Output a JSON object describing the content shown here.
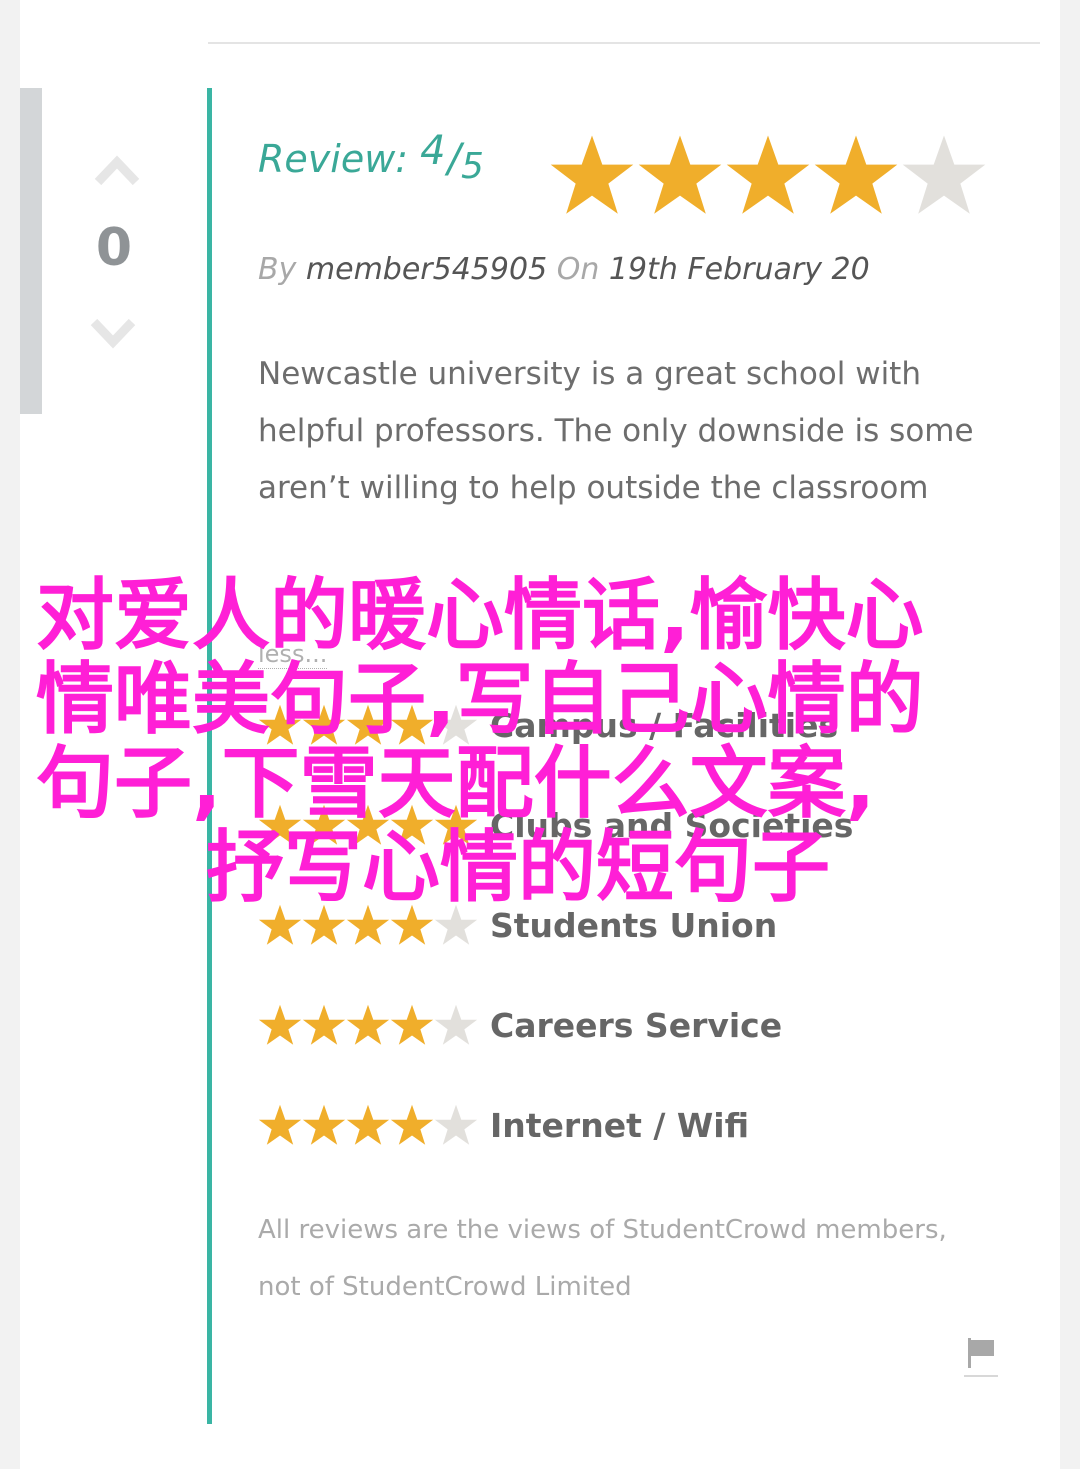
{
  "vote": {
    "count": "0",
    "up_icon": "chevron-up-icon",
    "down_icon": "chevron-down-icon"
  },
  "review": {
    "label": "Review:",
    "score": "4",
    "separator": "/",
    "max": "5",
    "stars_filled": 4,
    "stars_total": 5,
    "by_label": "By",
    "author": "member545905",
    "on_label": "On",
    "date": "19th February 20",
    "body": "Newcastle university is a great school with helpful professors. The only downside is some aren’t willing to help outside the classroom",
    "less_link": "less..."
  },
  "ratings": [
    {
      "label": "Campus / Facilities",
      "stars": 4
    },
    {
      "label": "Clubs and Societies",
      "stars": 5
    },
    {
      "label": "Students Union",
      "stars": 4
    },
    {
      "label": "Careers Service",
      "stars": 4
    },
    {
      "label": "Internet / Wifi",
      "stars": 4
    }
  ],
  "disclaimer": {
    "line1": "All reviews are the views of StudentCrowd members,",
    "line2": "not of StudentCrowd Limited"
  },
  "flag_icon": "flag-icon",
  "overlay": {
    "line1": "对爱人的暖心情话,愉快心",
    "line2": "情唯美句子,写自己心情的",
    "line3": "句子,下雪天配什么文案,",
    "line4": "抒写心情的短句子"
  },
  "colors": {
    "accent_teal": "#3ab5a4",
    "star_gold": "#f0ae2b",
    "star_empty": "#e2e0dc",
    "overlay_magenta": "#ff1fd6"
  }
}
